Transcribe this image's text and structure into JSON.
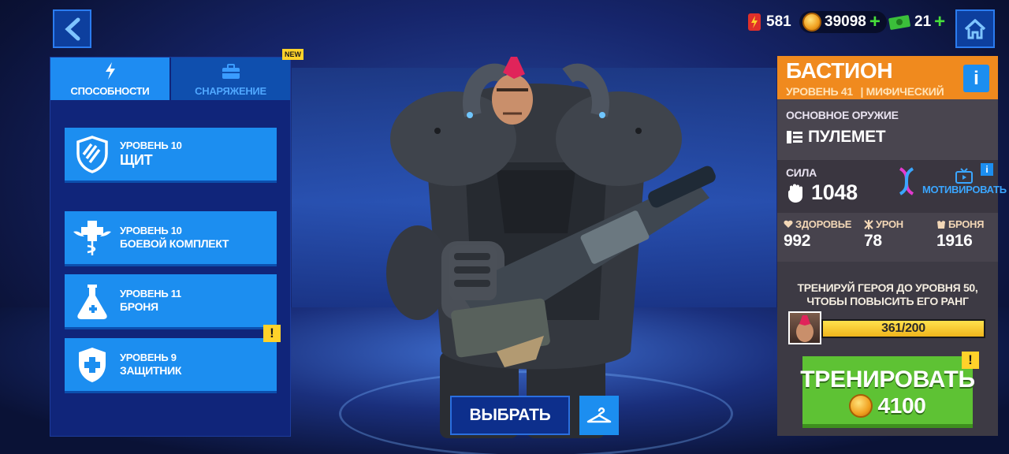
{
  "currencies": {
    "energy": "581",
    "coins": "39098",
    "cash": "21"
  },
  "tabs": {
    "abilities": "СПОСОБНОСТИ",
    "equipment": "СНАРЯЖЕНИЕ",
    "new_badge": "NEW"
  },
  "abilities": [
    {
      "level": "УРОВЕНЬ 10",
      "name": "ЩИТ",
      "icon": "shield-stripes-icon"
    },
    {
      "level": "УРОВЕНЬ 10",
      "name": "БОЕВОЙ КОМПЛЕКТ",
      "icon": "winged-medic-icon"
    },
    {
      "level": "УРОВЕНЬ 11",
      "name": "БРОНЯ",
      "icon": "flask-icon"
    },
    {
      "level": "УРОВЕНЬ 9",
      "name": "ЗАЩИТНИК",
      "icon": "shield-cross-icon"
    }
  ],
  "warn_mark": "!",
  "select_label": "ВЫБРАТЬ",
  "hero": {
    "name": "БАСТИОН",
    "level": "УРОВЕНЬ 41",
    "rarity": "| МИФИЧЕСКИЙ",
    "info": "i",
    "weapon_title": "ОСНОВНОЕ ОРУЖИЕ",
    "weapon": "ПУЛЕМЕТ",
    "power_label": "СИЛА",
    "power": "1048",
    "motivate": "МОТИВИРОВАТЬ",
    "stats": [
      {
        "label": "ЗДОРОВЬЕ",
        "value": "992",
        "icon": "heart-icon"
      },
      {
        "label": "УРОН",
        "value": "78",
        "icon": "damage-icon"
      },
      {
        "label": "БРОНЯ",
        "value": "1916",
        "icon": "armor-icon"
      }
    ],
    "train_message": "ТРЕНИРУЙ ГЕРОЯ ДО УРОВНЯ 50, ЧТОБЫ ПОВЫСИТЬ ЕГО РАНГ",
    "xp_text": "361/200",
    "xp_fraction": 1.0,
    "train_label": "ТРЕНИРОВАТЬ",
    "train_cost": "4100"
  },
  "colors": {
    "accent_blue": "#1c8ef0",
    "orange": "#f08a1e",
    "green": "#5ec234",
    "warning": "#ffd22a"
  }
}
